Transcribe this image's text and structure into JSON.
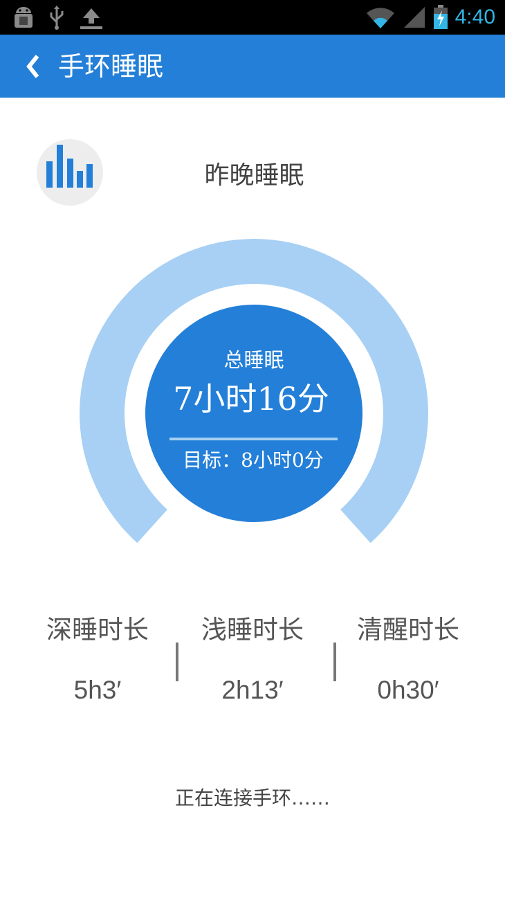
{
  "status_bar": {
    "time": "4:40",
    "icons": [
      "android-debug-icon",
      "usb-icon",
      "upload-icon",
      "wifi-icon",
      "signal-icon",
      "battery-charging-icon"
    ]
  },
  "app_bar": {
    "back_icon": "chevron-left-icon",
    "title": "手环睡眠"
  },
  "summary": {
    "icon": "bar-chart-icon",
    "title": "昨晚睡眠",
    "total_label": "总睡眠",
    "total_value": "7小时16分",
    "goal_text": "目标：8小时0分",
    "progress_fraction": 0.91
  },
  "stats": [
    {
      "label": "深睡时长",
      "value": "5h3′"
    },
    {
      "label": "浅睡时长",
      "value": "2h13′"
    },
    {
      "label": "清醒时长",
      "value": "0h30′"
    }
  ],
  "status_message": "正在连接手环……",
  "colors": {
    "primary": "#237fd8",
    "ring_light": "#a7d0f4",
    "status_time": "#33b5e5",
    "text_gray": "#555555"
  }
}
